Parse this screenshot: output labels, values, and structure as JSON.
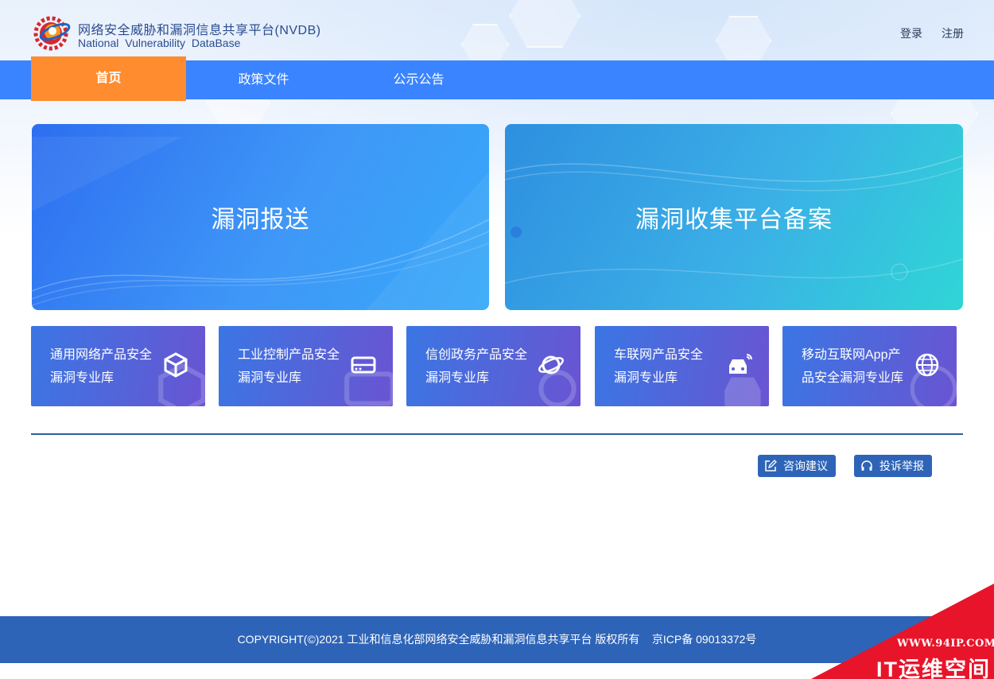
{
  "header": {
    "site_title_cn": "网络安全威胁和漏洞信息共享平台(NVDB)",
    "site_title_en": "National  Vulnerability DataBase",
    "login": "登录",
    "register": "注册"
  },
  "nav": {
    "items": [
      {
        "label": "首页",
        "active": true
      },
      {
        "label": "政策文件",
        "active": false
      },
      {
        "label": "公示公告",
        "active": false
      }
    ]
  },
  "main": {
    "big_cards": [
      {
        "label": "漏洞报送"
      },
      {
        "label": "漏洞收集平台备案"
      }
    ],
    "libraries": [
      {
        "line1": "通用网络产品安全",
        "line2": "漏洞专业库",
        "icon": "cube-icon"
      },
      {
        "line1": "工业控制产品安全",
        "line2": "漏洞专业库",
        "icon": "router-icon"
      },
      {
        "line1": "信创政务产品安全",
        "line2": "漏洞专业库",
        "icon": "planet-icon"
      },
      {
        "line1": "车联网产品安全",
        "line2": "漏洞专业库",
        "icon": "connected-car-icon"
      },
      {
        "line1": "移动互联网App产",
        "line2": "品安全漏洞专业库",
        "icon": "globe-icon"
      }
    ],
    "actions": {
      "consult": "咨询建议",
      "complaint": "投诉举报"
    }
  },
  "footer": {
    "copyright": "COPYRIGHT(©)2021 工业和信息化部网络安全威胁和漏洞信息共享平台 版权所有    京ICP备 09013372号"
  },
  "watermark": {
    "url": "WWW.94IP.COM",
    "brand": "IT运维空间"
  },
  "colors": {
    "nav_bg": "#3a84ff",
    "nav_active": "#ff8c2e",
    "footer_bg": "#2e64b8",
    "watermark_red": "#e8142a"
  }
}
